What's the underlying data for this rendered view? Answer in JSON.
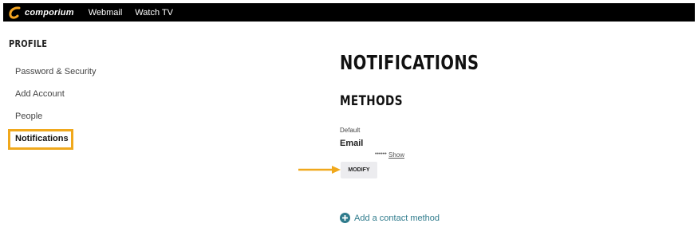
{
  "header": {
    "logo_text": "comporium",
    "nav": [
      "Webmail",
      "Watch TV"
    ]
  },
  "sidebar": {
    "heading": "PROFILE",
    "items": [
      {
        "label": "Password & Security"
      },
      {
        "label": "Add Account"
      },
      {
        "label": "People"
      },
      {
        "label": "Notifications",
        "active": true
      }
    ]
  },
  "main": {
    "title": "NOTIFICATIONS",
    "section_title": "METHODS",
    "method": {
      "label": "Default",
      "value": "Email",
      "masked": "••••••",
      "show_label": "Show",
      "modify_label": "MODIFY"
    },
    "add_contact_label": "Add a contact method"
  },
  "colors": {
    "highlight": "#f0a81c",
    "logo_accent": "#f5a623",
    "link": "#2f7b8c"
  },
  "icons": [
    "comporium-logo-icon",
    "arrow-right-icon",
    "plus-circle-icon"
  ]
}
